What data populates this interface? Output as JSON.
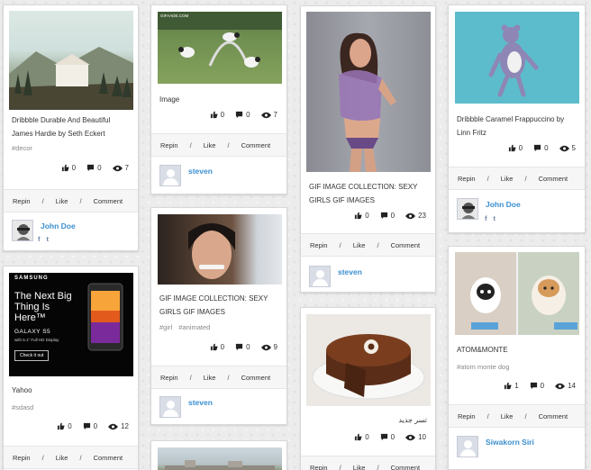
{
  "actions": {
    "repin": "Repin",
    "like": "Like",
    "comment": "Comment",
    "separator": "/"
  },
  "pins": [
    {
      "title": "Dribbble Durable And Beautiful James Hardie by Seth Eckert",
      "tags": [
        "#decor"
      ],
      "likes": "0",
      "comments": "0",
      "views": "7",
      "user": "John Doe",
      "social": [
        "f",
        "t"
      ]
    },
    {
      "title": "Image",
      "tags": [],
      "likes": "0",
      "comments": "0",
      "views": "7",
      "user": "steven",
      "image_caption": "GIFAADE.COM"
    },
    {
      "title": "GIF IMAGE COLLECTION: SEXY GIRLS GIF IMAGES",
      "tags": [],
      "likes": "0",
      "comments": "0",
      "views": "23",
      "user": "steven"
    },
    {
      "title": "Dribbble Caramel Frappuccino by Linn Fritz",
      "tags": [],
      "likes": "0",
      "comments": "0",
      "views": "5",
      "user": "John Doe",
      "social": [
        "f",
        "t"
      ]
    },
    {
      "title": "Yahoo",
      "tags": [
        "#sdasd"
      ],
      "likes": "0",
      "comments": "0",
      "views": "12",
      "ad": {
        "brand": "SAMSUNG",
        "headline": "The Next Big Thing Is Here™",
        "model": "GALAXY S5",
        "spec": "with 5.1\" Full HD Display",
        "cta": "Check it out"
      }
    },
    {
      "title": "GIF IMAGE COLLECTION: SEXY GIRLS GIF IMAGES",
      "tags": [
        "#girl",
        "#animated"
      ],
      "likes": "0",
      "comments": "0",
      "views": "9",
      "user": "steven"
    },
    {
      "title": "تسر جديد",
      "tags": [],
      "likes": "0",
      "comments": "0",
      "views": "10"
    },
    {
      "title": "ATOM&MONTE",
      "tags": [
        "#atom monte dog"
      ],
      "likes": "1",
      "comments": "0",
      "views": "14",
      "user": "Siwakorn Siri"
    }
  ]
}
